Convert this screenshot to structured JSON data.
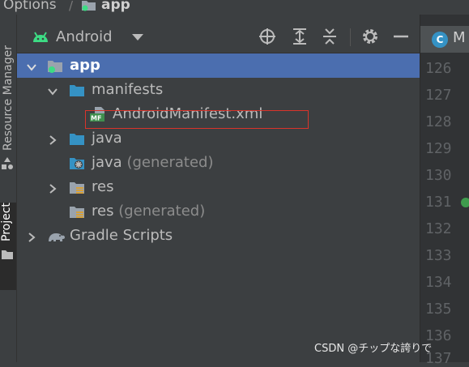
{
  "breadcrumb": {
    "parent": "Options",
    "separator": "/",
    "current": "app"
  },
  "sidebar": {
    "resource_manager": "Resource Manager",
    "project": "Project"
  },
  "panel": {
    "view_selector": "Android"
  },
  "tree": {
    "items": [
      {
        "label": "app"
      },
      {
        "label": "manifests"
      },
      {
        "label": "AndroidManifest.xml",
        "badge": "MF"
      },
      {
        "label": "java"
      },
      {
        "label": "java",
        "suffix": "(generated)"
      },
      {
        "label": "res"
      },
      {
        "label": "res",
        "suffix": "(generated)"
      },
      {
        "label": "Gradle Scripts"
      }
    ]
  },
  "editor": {
    "tab": {
      "icon_letter": "C",
      "label": "M"
    },
    "line_numbers": [
      "126",
      "127",
      "128",
      "129",
      "130",
      "131",
      "132",
      "133",
      "134",
      "135",
      "136",
      "137"
    ]
  },
  "watermark": "CSDN @チップな誇りで",
  "colors": {
    "selection": "#4b6eaf",
    "folder": "#3592c4",
    "android": "#3ddc84",
    "highlight": "#d9342b"
  }
}
